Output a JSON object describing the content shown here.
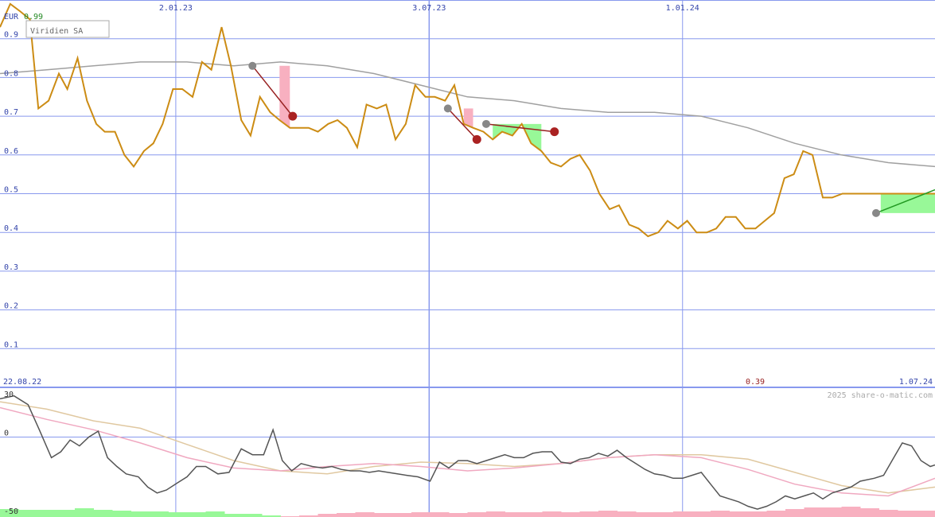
{
  "chart_data": [
    {
      "type": "line",
      "title": "Viridien SA",
      "currency": "EUR",
      "currency_value": "0.99",
      "ylim": [
        0,
        1.0
      ],
      "y_ticks": [
        "0.9",
        "0.8",
        "0.7",
        "0.6",
        "0.5",
        "0.4",
        "0.3",
        "0.2",
        "0.1"
      ],
      "x_date_labels": [
        "2.01.23",
        "3.07.23",
        "1.01.24"
      ],
      "x_start_label": "22.08.22",
      "x_end_label": "1.07.24",
      "current_value_label": "0.39",
      "watermark": "2025 share-o-matic.com",
      "grid": true,
      "colors": {
        "price": "#cc8c14",
        "moving_average": "#a0a0a0",
        "grid": "#8899ee",
        "gain_fill": "#98f898",
        "loss_fill": "#f8b0c0",
        "down_signal": "#992222",
        "up_signal": "#229922"
      },
      "series": [
        {
          "role": "price",
          "x": [
            0,
            0.011,
            0.022,
            0.032,
            0.041,
            0.052,
            0.063,
            0.072,
            0.083,
            0.093,
            0.103,
            0.112,
            0.123,
            0.133,
            0.143,
            0.154,
            0.164,
            0.174,
            0.185,
            0.195,
            0.206,
            0.216,
            0.226,
            0.237,
            0.247,
            0.258,
            0.268,
            0.278,
            0.289,
            0.299,
            0.31,
            0.32,
            0.33,
            0.34,
            0.351,
            0.361,
            0.371,
            0.382,
            0.392,
            0.403,
            0.413,
            0.423,
            0.434,
            0.444,
            0.455,
            0.465,
            0.476,
            0.486,
            0.496,
            0.506,
            0.517,
            0.527,
            0.537,
            0.548,
            0.558,
            0.568,
            0.579,
            0.589,
            0.6,
            0.61,
            0.62,
            0.631,
            0.641,
            0.652,
            0.662,
            0.673,
            0.683,
            0.693,
            0.704,
            0.714,
            0.725,
            0.735,
            0.745,
            0.756,
            0.766,
            0.776,
            0.787,
            0.797,
            0.808,
            0.818,
            0.828,
            0.839,
            0.849,
            0.859,
            0.869,
            0.88,
            0.89,
            0.901,
            0.911,
            0.921,
            0.932,
            0.942,
            0.953,
            0.963,
            0.973,
            0.984,
            0.994,
            1.0
          ],
          "y": [
            0.93,
            0.99,
            0.97,
            0.95,
            0.72,
            0.74,
            0.81,
            0.77,
            0.85,
            0.74,
            0.68,
            0.66,
            0.66,
            0.6,
            0.57,
            0.61,
            0.63,
            0.68,
            0.77,
            0.77,
            0.75,
            0.84,
            0.82,
            0.93,
            0.83,
            0.69,
            0.65,
            0.75,
            0.71,
            0.69,
            0.67,
            0.67,
            0.67,
            0.66,
            0.68,
            0.69,
            0.67,
            0.62,
            0.73,
            0.72,
            0.73,
            0.64,
            0.68,
            0.78,
            0.75,
            0.75,
            0.74,
            0.78,
            0.68,
            0.67,
            0.66,
            0.64,
            0.66,
            0.65,
            0.68,
            0.63,
            0.61,
            0.58,
            0.57,
            0.59,
            0.6,
            0.56,
            0.5,
            0.46,
            0.47,
            0.42,
            0.41,
            0.39,
            0.4,
            0.43,
            0.41,
            0.43,
            0.4,
            0.4,
            0.41,
            0.44,
            0.44,
            0.41,
            0.41,
            0.43,
            0.45,
            0.54,
            0.55,
            0.61,
            0.6,
            0.49,
            0.49,
            0.5,
            0.5,
            0.5,
            0.5,
            0.5,
            0.5,
            0.5,
            0.5,
            0.5,
            0.5,
            0.5
          ]
        },
        {
          "role": "moving_average",
          "x": [
            0,
            0.05,
            0.1,
            0.15,
            0.2,
            0.25,
            0.3,
            0.35,
            0.4,
            0.45,
            0.5,
            0.55,
            0.6,
            0.65,
            0.7,
            0.75,
            0.8,
            0.85,
            0.9,
            0.95,
            1.0
          ],
          "y": [
            0.81,
            0.82,
            0.83,
            0.84,
            0.84,
            0.83,
            0.84,
            0.83,
            0.81,
            0.78,
            0.75,
            0.74,
            0.72,
            0.71,
            0.71,
            0.7,
            0.67,
            0.63,
            0.6,
            0.58,
            0.57
          ]
        }
      ],
      "signals": [
        {
          "x0": 0.27,
          "y0": 0.83,
          "x1": 0.313,
          "y1": 0.7,
          "kind": "down"
        },
        {
          "x0": 0.479,
          "y0": 0.72,
          "x1": 0.51,
          "y1": 0.64,
          "kind": "down"
        },
        {
          "x0": 0.52,
          "y0": 0.68,
          "x1": 0.593,
          "y1": 0.66,
          "kind": "down"
        },
        {
          "x0": 0.937,
          "y0": 0.45,
          "x1": 1.0,
          "y1": 0.51,
          "kind": "up"
        }
      ]
    },
    {
      "type": "line",
      "title": "",
      "y_ticks": [
        "30",
        "0",
        "-50"
      ],
      "ylim": [
        -50,
        30
      ],
      "series": [
        {
          "role": "oscillator",
          "x": [
            0,
            0.015,
            0.03,
            0.042,
            0.055,
            0.065,
            0.075,
            0.085,
            0.095,
            0.105,
            0.115,
            0.125,
            0.135,
            0.148,
            0.158,
            0.168,
            0.178,
            0.19,
            0.2,
            0.21,
            0.22,
            0.233,
            0.245,
            0.258,
            0.27,
            0.282,
            0.292,
            0.302,
            0.312,
            0.322,
            0.334,
            0.345,
            0.355,
            0.365,
            0.375,
            0.385,
            0.395,
            0.405,
            0.415,
            0.425,
            0.435,
            0.447,
            0.46,
            0.47,
            0.48,
            0.49,
            0.5,
            0.51,
            0.52,
            0.53,
            0.54,
            0.55,
            0.56,
            0.57,
            0.58,
            0.59,
            0.6,
            0.61,
            0.62,
            0.63,
            0.64,
            0.65,
            0.66,
            0.67,
            0.68,
            0.69,
            0.7,
            0.71,
            0.72,
            0.73,
            0.74,
            0.75,
            0.76,
            0.77,
            0.78,
            0.79,
            0.8,
            0.81,
            0.82,
            0.83,
            0.84,
            0.85,
            0.86,
            0.87,
            0.88,
            0.89,
            0.9,
            0.91,
            0.92,
            0.935,
            0.945,
            0.955,
            0.965,
            0.975,
            0.985,
            0.995,
            1.0
          ],
          "y": [
            26,
            28,
            22,
            5,
            -14,
            -10,
            -2,
            -6,
            0,
            4,
            -14,
            -20,
            -25,
            -27,
            -34,
            -38,
            -36,
            -31,
            -27,
            -20,
            -20,
            -25,
            -24,
            -8,
            -12,
            -12,
            5,
            -16,
            -23,
            -18,
            -20,
            -21,
            -20,
            -22,
            -23,
            -23,
            -24,
            -23,
            -24,
            -25,
            -26,
            -27,
            -30,
            -17,
            -21,
            -16,
            -16,
            -18,
            -16,
            -14,
            -12,
            -14,
            -14,
            -11,
            -10,
            -10,
            -17,
            -18,
            -15,
            -14,
            -11,
            -13,
            -9,
            -14,
            -18,
            -22,
            -25,
            -26,
            -28,
            -28,
            -26,
            -24,
            -32,
            -40,
            -42,
            -44,
            -47,
            -49,
            -47,
            -44,
            -40,
            -42,
            -40,
            -38,
            -42,
            -38,
            -36,
            -34,
            -30,
            -28,
            -26,
            -15,
            -4,
            -6,
            -16,
            -20,
            -19
          ]
        },
        {
          "role": "signal_line",
          "x": [
            0,
            0.05,
            0.1,
            0.15,
            0.2,
            0.25,
            0.3,
            0.35,
            0.4,
            0.45,
            0.5,
            0.55,
            0.6,
            0.65,
            0.7,
            0.75,
            0.8,
            0.85,
            0.9,
            0.95,
            1.0
          ],
          "y": [
            20,
            12,
            5,
            -4,
            -14,
            -21,
            -23,
            -20,
            -18,
            -20,
            -23,
            -21,
            -18,
            -14,
            -12,
            -14,
            -22,
            -32,
            -38,
            -40,
            -28
          ]
        },
        {
          "role": "slow_line",
          "x": [
            0,
            0.05,
            0.1,
            0.15,
            0.2,
            0.25,
            0.3,
            0.35,
            0.4,
            0.45,
            0.5,
            0.55,
            0.6,
            0.65,
            0.7,
            0.75,
            0.8,
            0.85,
            0.9,
            0.95,
            1.0
          ],
          "y": [
            24,
            19,
            11,
            6,
            -5,
            -16,
            -23,
            -25,
            -20,
            -17,
            -18,
            -20,
            -18,
            -14,
            -12,
            -12,
            -15,
            -24,
            -33,
            -38,
            -34
          ]
        }
      ],
      "volume_bars": {
        "colors": [
          "#98f898",
          "#f8b0c0"
        ],
        "x": [
          0,
          0.02,
          0.04,
          0.06,
          0.08,
          0.1,
          0.12,
          0.14,
          0.16,
          0.18,
          0.2,
          0.22,
          0.24,
          0.26,
          0.28,
          0.3,
          0.32,
          0.34,
          0.36,
          0.38,
          0.4,
          0.42,
          0.44,
          0.46,
          0.48,
          0.5,
          0.52,
          0.54,
          0.56,
          0.58,
          0.6,
          0.62,
          0.64,
          0.66,
          0.68,
          0.7,
          0.72,
          0.74,
          0.76,
          0.78,
          0.8,
          0.82,
          0.84,
          0.86,
          0.88,
          0.9,
          0.92,
          0.94,
          0.96,
          0.98
        ],
        "v": [
          10,
          9,
          9,
          9,
          11,
          9,
          8,
          7,
          7,
          6,
          6,
          7,
          4,
          4,
          2,
          1,
          2,
          4,
          5,
          6,
          5,
          5,
          6,
          6,
          5,
          6,
          7,
          6,
          6,
          7,
          6,
          7,
          8,
          7,
          6,
          6,
          7,
          7,
          8,
          7,
          7,
          8,
          10,
          12,
          12,
          13,
          11,
          9,
          8,
          8
        ],
        "sign": [
          1,
          1,
          1,
          1,
          1,
          1,
          1,
          1,
          1,
          1,
          1,
          1,
          1,
          1,
          1,
          -1,
          -1,
          -1,
          -1,
          -1,
          -1,
          -1,
          -1,
          -1,
          -1,
          -1,
          -1,
          -1,
          -1,
          -1,
          -1,
          -1,
          -1,
          -1,
          -1,
          -1,
          -1,
          -1,
          -1,
          -1,
          -1,
          -1,
          -1,
          -1,
          -1,
          -1,
          -1,
          -1,
          -1,
          -1
        ]
      }
    }
  ]
}
